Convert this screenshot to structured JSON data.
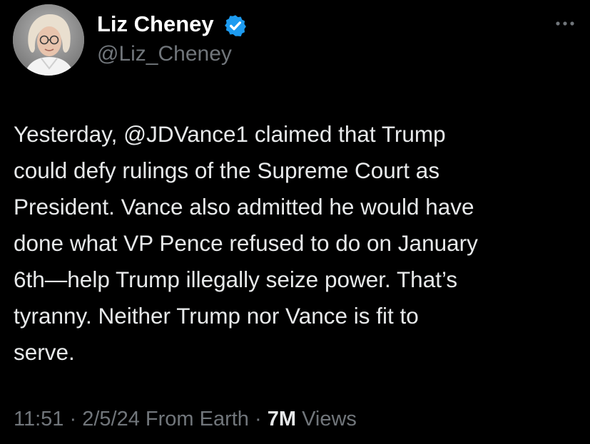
{
  "author": {
    "display_name": "Liz Cheney",
    "handle": "@Liz_Cheney",
    "verified_badge_color": "#1d9bf0",
    "avatar_icon": "profile-photo"
  },
  "menu": {
    "more_icon": "ellipsis-icon"
  },
  "tweet": {
    "lines": [
      "Yesterday, @JDVance1 claimed that  Trump",
      "could defy rulings of the Supreme Court as",
      "President.  Vance also admitted he would have",
      "done what VP Pence refused to do on January",
      "6th—help Trump illegally seize power.  That’s",
      "tyranny. Neither Trump nor Vance is fit to",
      "serve."
    ]
  },
  "meta": {
    "time": "11:51",
    "separator": " · ",
    "date": "2/5/24",
    "source": " From Earth",
    "views_count": "7M",
    "views_label": " Views"
  },
  "colors": {
    "background": "#000000",
    "primary_text": "#e7e9ea",
    "secondary_text": "#71767b"
  }
}
